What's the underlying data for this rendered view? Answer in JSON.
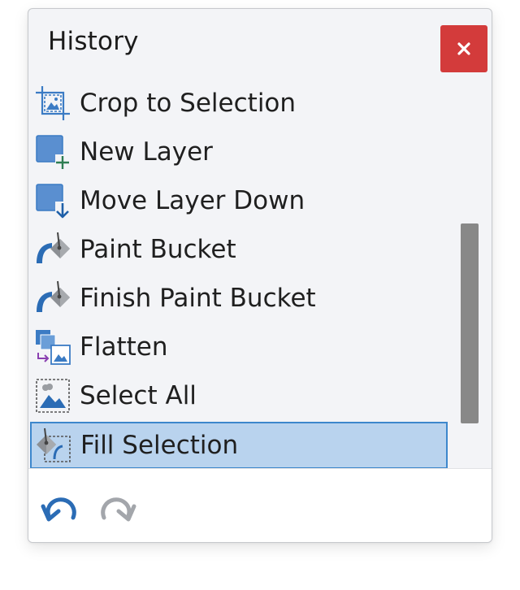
{
  "panel": {
    "title": "History",
    "close_label": "×"
  },
  "history": {
    "items": [
      {
        "label": "Crop to Selection",
        "icon": "crop-to-selection-icon"
      },
      {
        "label": "New Layer",
        "icon": "new-layer-icon"
      },
      {
        "label": "Move Layer Down",
        "icon": "move-layer-down-icon"
      },
      {
        "label": "Paint Bucket",
        "icon": "paint-bucket-icon"
      },
      {
        "label": "Finish Paint Bucket",
        "icon": "finish-paint-bucket-icon"
      },
      {
        "label": "Flatten",
        "icon": "flatten-icon"
      },
      {
        "label": "Select All",
        "icon": "select-all-icon"
      },
      {
        "label": "Fill Selection",
        "icon": "fill-selection-icon",
        "selected": true
      }
    ]
  },
  "footer": {
    "undo_icon": "undo-icon",
    "redo_icon": "redo-icon"
  },
  "colors": {
    "close_button": "#d33b3b",
    "selection_fill": "#b9d3ee",
    "selection_border": "#3d87cc",
    "icon_blue": "#3b7bc4",
    "scrollbar": "#888888"
  }
}
